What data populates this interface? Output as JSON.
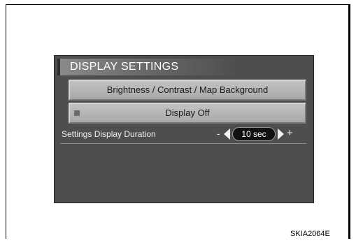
{
  "screen": {
    "title": "DISPLAY SETTINGS",
    "menu": [
      {
        "label": "Brightness / Contrast / Map Background"
      },
      {
        "label": "Display Off"
      }
    ],
    "setting": {
      "label": "Settings Display Duration",
      "minus": "-",
      "value": "10 sec",
      "plus": "+"
    }
  },
  "caption": "SKIA2064E"
}
